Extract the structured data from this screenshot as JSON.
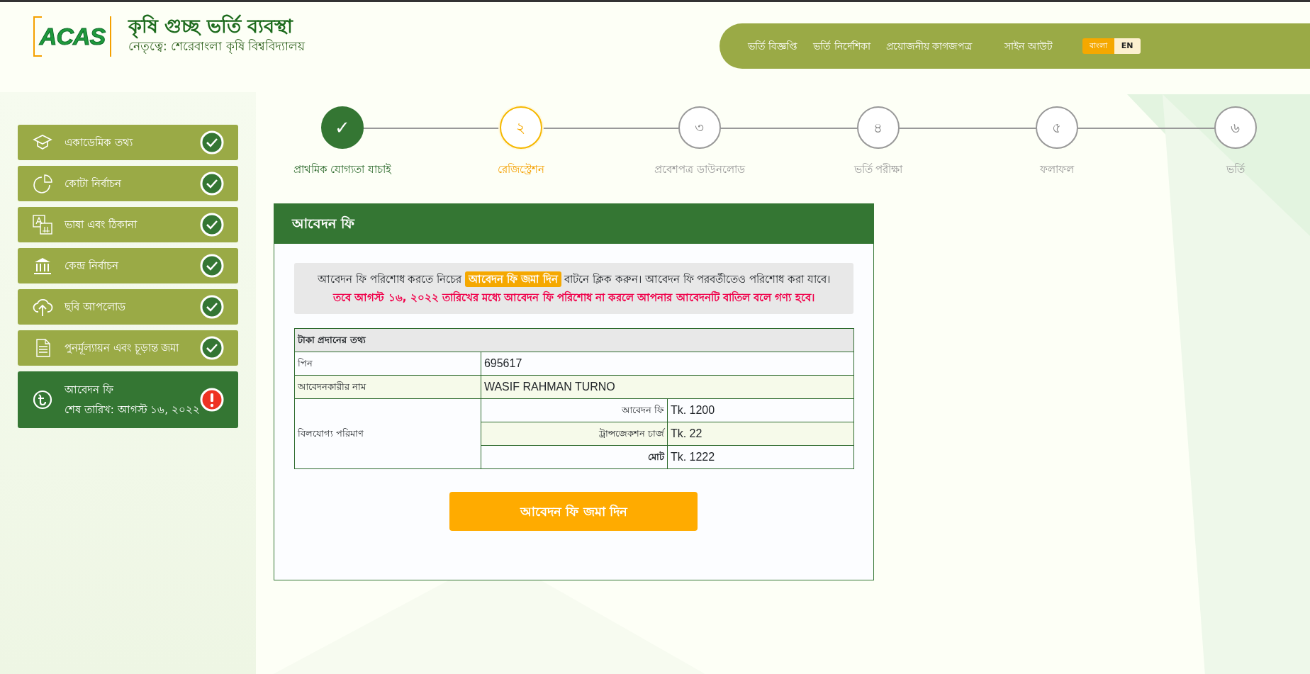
{
  "header": {
    "logo": "ACAS",
    "title": "কৃষি গুচ্ছ ভর্তি ব্যবস্থা",
    "subtitle": "নেতৃত্বে: শেরেবাংলা কৃষি বিশ্ববিদ্যালয়",
    "nav": [
      "ভর্তি বিজ্ঞপ্তি",
      "ভর্তি নির্দেশিকা",
      "প্রয়োজনীয় কাগজপত্র"
    ],
    "sign_out": "সাইন আউট",
    "languages": [
      {
        "label": "বাংলা",
        "selected": true
      },
      {
        "label": "EN",
        "selected": false
      }
    ]
  },
  "sidebar": {
    "items": [
      {
        "label": "একাডেমিক তথ্য",
        "completed": true,
        "selected": false
      },
      {
        "label": "কোটা নির্বাচন",
        "completed": true,
        "selected": false
      },
      {
        "label": "ভাষা এবং ঠিকানা",
        "completed": true,
        "selected": false
      },
      {
        "label": "কেন্দ্র নির্বাচন",
        "completed": true,
        "selected": false
      },
      {
        "label": "ছবি আপলোড",
        "completed": true,
        "selected": false
      },
      {
        "label": "পুনর্মূল্যায়ন এবং চূড়ান্ত জমা",
        "completed": true,
        "selected": false
      },
      {
        "label": "আবেদন ফি",
        "deadline": "শেষ তারিখ: আগস্ট ১৬, ২০২২",
        "completed": false,
        "selected": true
      }
    ]
  },
  "steps": [
    {
      "number": "✓",
      "label": "প্রাথমিক যোগ্যতা যাচাই",
      "completed": true,
      "selected": false
    },
    {
      "number": "২",
      "label": "রেজিস্ট্রেশন",
      "completed": false,
      "selected": true
    },
    {
      "number": "৩",
      "label": "প্রবেশপত্র ডাউনলোড",
      "completed": false,
      "selected": false
    },
    {
      "number": "৪",
      "label": "ভর্তি পরীক্ষা",
      "completed": false,
      "selected": false
    },
    {
      "number": "৫",
      "label": "ফলাফল",
      "completed": false,
      "selected": false
    },
    {
      "number": "৬",
      "label": "ভর্তি",
      "completed": false,
      "selected": false
    }
  ],
  "card": {
    "title": "আবেদন ফি",
    "notice": {
      "before": "আবেদন ফি পরিশোধ করতে নিচের",
      "highlight": "আবেদন ফি জমা দিন",
      "after": "বাটনে ক্লিক করুন। আবেদন ফি পরবর্তীতেও পরিশোধ করা যাবে।",
      "warning": "তবে আগস্ট ১৬, ২০২২ তারিখের মধ্যে আবেদন ফি পরিশোধ না করলে আপনার আবেদনটি বাতিল বলে গণ্য হবে।"
    },
    "table": {
      "title": "টাকা প্রদানের তথ্য",
      "rows": [
        {
          "label": "পিন",
          "value": "695617"
        },
        {
          "label": "আবেদনকারীর নাম",
          "value": "WASIF RAHMAN TURNO"
        }
      ],
      "bill": {
        "label": "বিলযোগ্য পরিমাণ",
        "items": [
          {
            "label": "আবেদন ফি",
            "value": "Tk. 1200",
            "total": false
          },
          {
            "label": "ট্রান্সজেকশন চার্জ",
            "value": "Tk. 22",
            "total": false
          },
          {
            "label": "মোট",
            "value": "Tk. 1222",
            "total": true
          }
        ]
      }
    },
    "button": "আবেদন ফি জমা দিন"
  }
}
